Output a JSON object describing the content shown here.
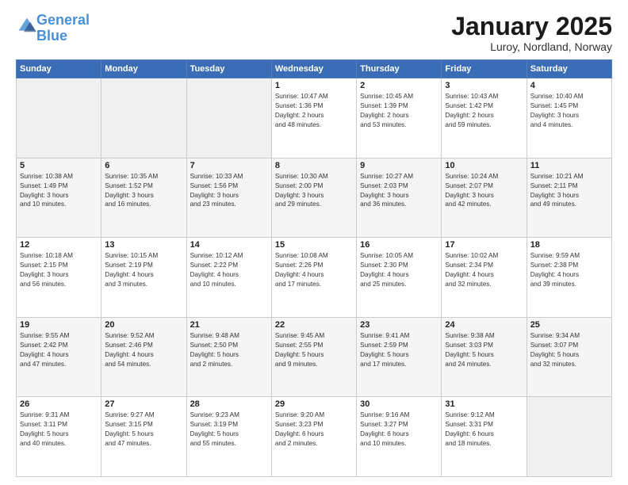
{
  "header": {
    "logo_line1": "General",
    "logo_line2": "Blue",
    "month": "January 2025",
    "location": "Luroy, Nordland, Norway"
  },
  "days_of_week": [
    "Sunday",
    "Monday",
    "Tuesday",
    "Wednesday",
    "Thursday",
    "Friday",
    "Saturday"
  ],
  "weeks": [
    [
      {
        "day": "",
        "detail": ""
      },
      {
        "day": "",
        "detail": ""
      },
      {
        "day": "",
        "detail": ""
      },
      {
        "day": "1",
        "detail": "Sunrise: 10:47 AM\nSunset: 1:36 PM\nDaylight: 2 hours\nand 48 minutes."
      },
      {
        "day": "2",
        "detail": "Sunrise: 10:45 AM\nSunset: 1:39 PM\nDaylight: 2 hours\nand 53 minutes."
      },
      {
        "day": "3",
        "detail": "Sunrise: 10:43 AM\nSunset: 1:42 PM\nDaylight: 2 hours\nand 59 minutes."
      },
      {
        "day": "4",
        "detail": "Sunrise: 10:40 AM\nSunset: 1:45 PM\nDaylight: 3 hours\nand 4 minutes."
      }
    ],
    [
      {
        "day": "5",
        "detail": "Sunrise: 10:38 AM\nSunset: 1:49 PM\nDaylight: 3 hours\nand 10 minutes."
      },
      {
        "day": "6",
        "detail": "Sunrise: 10:35 AM\nSunset: 1:52 PM\nDaylight: 3 hours\nand 16 minutes."
      },
      {
        "day": "7",
        "detail": "Sunrise: 10:33 AM\nSunset: 1:56 PM\nDaylight: 3 hours\nand 23 minutes."
      },
      {
        "day": "8",
        "detail": "Sunrise: 10:30 AM\nSunset: 2:00 PM\nDaylight: 3 hours\nand 29 minutes."
      },
      {
        "day": "9",
        "detail": "Sunrise: 10:27 AM\nSunset: 2:03 PM\nDaylight: 3 hours\nand 36 minutes."
      },
      {
        "day": "10",
        "detail": "Sunrise: 10:24 AM\nSunset: 2:07 PM\nDaylight: 3 hours\nand 42 minutes."
      },
      {
        "day": "11",
        "detail": "Sunrise: 10:21 AM\nSunset: 2:11 PM\nDaylight: 3 hours\nand 49 minutes."
      }
    ],
    [
      {
        "day": "12",
        "detail": "Sunrise: 10:18 AM\nSunset: 2:15 PM\nDaylight: 3 hours\nand 56 minutes."
      },
      {
        "day": "13",
        "detail": "Sunrise: 10:15 AM\nSunset: 2:19 PM\nDaylight: 4 hours\nand 3 minutes."
      },
      {
        "day": "14",
        "detail": "Sunrise: 10:12 AM\nSunset: 2:22 PM\nDaylight: 4 hours\nand 10 minutes."
      },
      {
        "day": "15",
        "detail": "Sunrise: 10:08 AM\nSunset: 2:26 PM\nDaylight: 4 hours\nand 17 minutes."
      },
      {
        "day": "16",
        "detail": "Sunrise: 10:05 AM\nSunset: 2:30 PM\nDaylight: 4 hours\nand 25 minutes."
      },
      {
        "day": "17",
        "detail": "Sunrise: 10:02 AM\nSunset: 2:34 PM\nDaylight: 4 hours\nand 32 minutes."
      },
      {
        "day": "18",
        "detail": "Sunrise: 9:59 AM\nSunset: 2:38 PM\nDaylight: 4 hours\nand 39 minutes."
      }
    ],
    [
      {
        "day": "19",
        "detail": "Sunrise: 9:55 AM\nSunset: 2:42 PM\nDaylight: 4 hours\nand 47 minutes."
      },
      {
        "day": "20",
        "detail": "Sunrise: 9:52 AM\nSunset: 2:46 PM\nDaylight: 4 hours\nand 54 minutes."
      },
      {
        "day": "21",
        "detail": "Sunrise: 9:48 AM\nSunset: 2:50 PM\nDaylight: 5 hours\nand 2 minutes."
      },
      {
        "day": "22",
        "detail": "Sunrise: 9:45 AM\nSunset: 2:55 PM\nDaylight: 5 hours\nand 9 minutes."
      },
      {
        "day": "23",
        "detail": "Sunrise: 9:41 AM\nSunset: 2:59 PM\nDaylight: 5 hours\nand 17 minutes."
      },
      {
        "day": "24",
        "detail": "Sunrise: 9:38 AM\nSunset: 3:03 PM\nDaylight: 5 hours\nand 24 minutes."
      },
      {
        "day": "25",
        "detail": "Sunrise: 9:34 AM\nSunset: 3:07 PM\nDaylight: 5 hours\nand 32 minutes."
      }
    ],
    [
      {
        "day": "26",
        "detail": "Sunrise: 9:31 AM\nSunset: 3:11 PM\nDaylight: 5 hours\nand 40 minutes."
      },
      {
        "day": "27",
        "detail": "Sunrise: 9:27 AM\nSunset: 3:15 PM\nDaylight: 5 hours\nand 47 minutes."
      },
      {
        "day": "28",
        "detail": "Sunrise: 9:23 AM\nSunset: 3:19 PM\nDaylight: 5 hours\nand 55 minutes."
      },
      {
        "day": "29",
        "detail": "Sunrise: 9:20 AM\nSunset: 3:23 PM\nDaylight: 6 hours\nand 2 minutes."
      },
      {
        "day": "30",
        "detail": "Sunrise: 9:16 AM\nSunset: 3:27 PM\nDaylight: 6 hours\nand 10 minutes."
      },
      {
        "day": "31",
        "detail": "Sunrise: 9:12 AM\nSunset: 3:31 PM\nDaylight: 6 hours\nand 18 minutes."
      },
      {
        "day": "",
        "detail": ""
      }
    ]
  ]
}
